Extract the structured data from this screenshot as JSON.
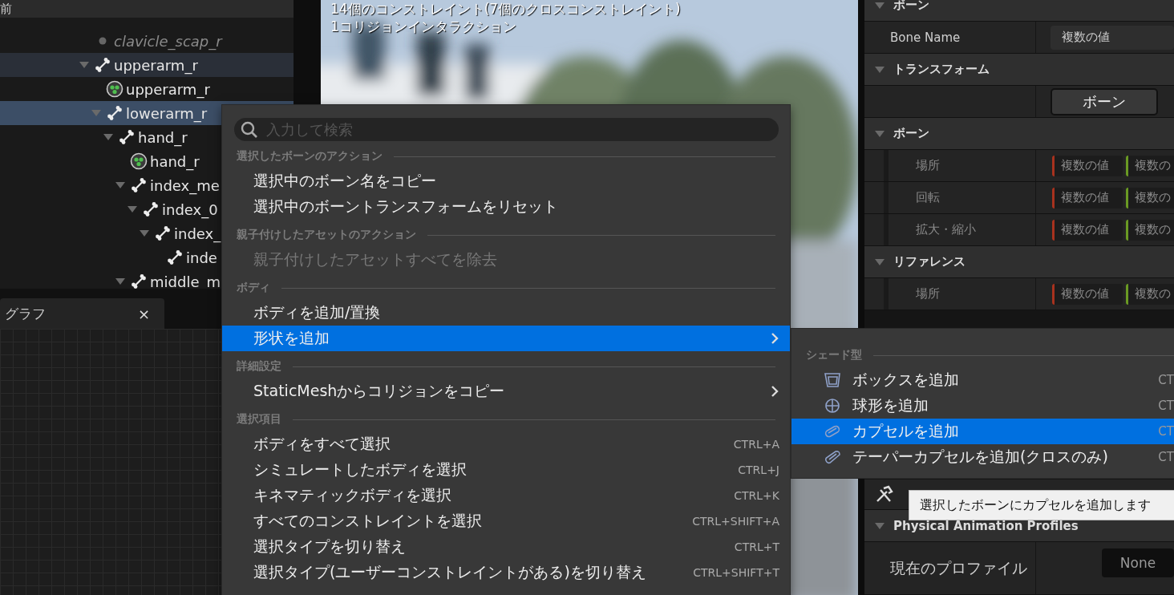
{
  "tree_panel": {
    "header": "前",
    "rows": [
      {
        "kind": "socket",
        "label": "clavicle_scap_r",
        "selected": false,
        "highlighted": false
      },
      {
        "kind": "bone",
        "label": "upperarm_r",
        "expanded": true,
        "selected": false,
        "highlighted": true,
        "children": [
          {
            "kind": "body",
            "label": "upperarm_r",
            "selected": false,
            "highlighted": false
          },
          {
            "kind": "bone",
            "label": "lowerarm_r",
            "expanded": true,
            "selected": true,
            "highlighted": false,
            "children": [
              {
                "kind": "bone",
                "label": "hand_r",
                "expanded": true,
                "selected": false,
                "highlighted": false,
                "children": [
                  {
                    "kind": "body",
                    "label": "hand_r",
                    "selected": false,
                    "highlighted": false
                  },
                  {
                    "kind": "bone",
                    "label": "index_me",
                    "expanded": true,
                    "selected": false,
                    "highlighted": false,
                    "children": [
                      {
                        "kind": "bone",
                        "label": "index_0",
                        "expanded": true,
                        "selected": false,
                        "highlighted": false,
                        "children": [
                          {
                            "kind": "bone",
                            "label": "index_",
                            "expanded": true,
                            "selected": false,
                            "highlighted": false,
                            "children": [
                              {
                                "kind": "bone",
                                "label": "inde",
                                "selected": false,
                                "highlighted": false
                              }
                            ]
                          }
                        ]
                      }
                    ]
                  },
                  {
                    "kind": "bone",
                    "label": "middle_m",
                    "expanded": true,
                    "selected": false,
                    "highlighted": false
                  }
                ]
              }
            ]
          }
        ]
      }
    ]
  },
  "graph_tab": {
    "label": "グラフ",
    "close": "×"
  },
  "viewport": {
    "overlay_lines": [
      "14個のコンストレイント(7個のクロスコンストレイント)",
      "1コリジョンインタラクション"
    ]
  },
  "details": {
    "rows": [
      {
        "kind": "category",
        "label": "ボーン",
        "expanded": true
      },
      {
        "kind": "text_field",
        "label": "Bone Name",
        "value": "複数の値"
      },
      {
        "kind": "category",
        "label": "トランスフォーム",
        "expanded": true
      },
      {
        "kind": "buttons",
        "buttons": [
          {
            "label": "ボーン",
            "selected": true
          }
        ]
      },
      {
        "kind": "category",
        "label": "ボーン",
        "expanded": true
      },
      {
        "kind": "vector",
        "label": "場所",
        "values": [
          "複数の値",
          "複数の"
        ]
      },
      {
        "kind": "vector",
        "label": "回転",
        "values": [
          "複数の値",
          "複数の"
        ]
      },
      {
        "kind": "vector",
        "label": "拡大・縮小",
        "values": [
          "複数の値",
          "複数の"
        ]
      },
      {
        "kind": "category",
        "label": "リファレンス",
        "expanded": true
      },
      {
        "kind": "vector",
        "label": "場所",
        "values": [
          "複数の値",
          "複数の"
        ]
      }
    ],
    "lower_rows": [
      {
        "kind": "toolbar"
      },
      {
        "kind": "category",
        "label": "Physical Animation Profiles",
        "expanded": true
      },
      {
        "kind": "dropdown",
        "label": "現在のプロファイル",
        "value": "None"
      }
    ]
  },
  "context_menu": {
    "search": {
      "placeholder": "入力して検索"
    },
    "sections": [
      {
        "heading": "選択したボーンのアクション",
        "items": [
          {
            "label": "選択中のボーン名をコピー",
            "disabled": false,
            "selected": false,
            "submenu": false
          },
          {
            "label": "選択中のボーントランスフォームをリセット",
            "disabled": false,
            "selected": false,
            "submenu": false
          }
        ]
      },
      {
        "heading": "親子付けしたアセットのアクション",
        "items": [
          {
            "label": "親子付けしたアセットすべてを除去",
            "disabled": true,
            "selected": false,
            "submenu": false
          }
        ]
      },
      {
        "heading": "ボディ",
        "items": [
          {
            "label": "ボディを追加/置換",
            "disabled": false,
            "selected": false,
            "submenu": false
          },
          {
            "label": "形状を追加",
            "disabled": false,
            "selected": true,
            "submenu": true
          }
        ]
      },
      {
        "heading": "詳細設定",
        "items": [
          {
            "label": "StaticMeshからコリジョンをコピー",
            "disabled": false,
            "selected": false,
            "submenu": true
          }
        ]
      },
      {
        "heading": "選択項目",
        "items": [
          {
            "label": "ボディをすべて選択",
            "shortcut": "CTRL+A",
            "disabled": false,
            "selected": false,
            "submenu": false
          },
          {
            "label": "シミュレートしたボディを選択",
            "shortcut": "CTRL+J",
            "disabled": false,
            "selected": false,
            "submenu": false
          },
          {
            "label": "キネマティックボディを選択",
            "shortcut": "CTRL+K",
            "disabled": false,
            "selected": false,
            "submenu": false
          },
          {
            "label": "すべてのコンストレイントを選択",
            "shortcut": "CTRL+SHIFT+A",
            "disabled": false,
            "selected": false,
            "submenu": false
          },
          {
            "label": "選択タイプを切り替え",
            "shortcut": "CTRL+T",
            "disabled": false,
            "selected": false,
            "submenu": false
          },
          {
            "label": "選択タイプ(ユーザーコンストレイントがある)を切り替え",
            "shortcut": "CTRL+SHIFT+T",
            "disabled": false,
            "selected": false,
            "submenu": false
          }
        ]
      }
    ]
  },
  "submenu": {
    "heading": "シェード型",
    "items": [
      {
        "kind": "box",
        "label": "ボックスを追加",
        "shortcut": "CT",
        "selected": false
      },
      {
        "kind": "sphere",
        "label": "球形を追加",
        "shortcut": "CT",
        "selected": false
      },
      {
        "kind": "capsule",
        "label": "カプセルを追加",
        "shortcut": "CT",
        "selected": true
      },
      {
        "kind": "tapered_capsule",
        "label": "テーパーカプセルを追加(クロスのみ)",
        "shortcut": "CT",
        "selected": false
      }
    ]
  },
  "tooltip": {
    "text": "選択したボーンにカプセルを追加します"
  }
}
